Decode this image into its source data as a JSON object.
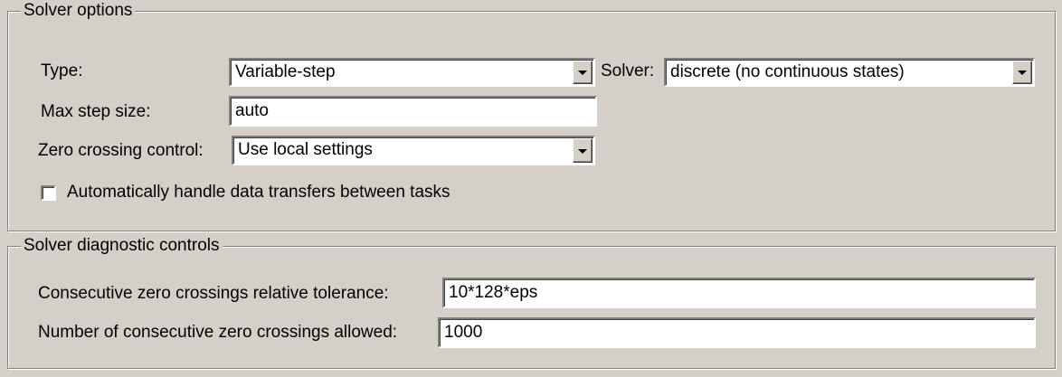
{
  "solver_options": {
    "title": "Solver options",
    "type_label": "Type:",
    "type_value": "Variable-step",
    "solver_label": "Solver:",
    "solver_value": "discrete (no continuous states)",
    "max_step_label": "Max step size:",
    "max_step_value": "auto",
    "zero_crossing_label": "Zero crossing control:",
    "zero_crossing_value": "Use local settings",
    "auto_transfer_label": "Automatically handle data transfers between tasks",
    "auto_transfer_checked": false
  },
  "diagnostic_controls": {
    "title": "Solver diagnostic controls",
    "rel_tol_label": "Consecutive zero crossings relative tolerance:",
    "rel_tol_value": "10*128*eps",
    "num_allowed_label": "Number of consecutive zero crossings allowed:",
    "num_allowed_value": "1000"
  },
  "colors": {
    "dialog_background": "#d4d0c8",
    "field_background": "#ffffff",
    "group_border": "#808080"
  },
  "icons": {
    "dropdown": "chevron-down-icon"
  }
}
